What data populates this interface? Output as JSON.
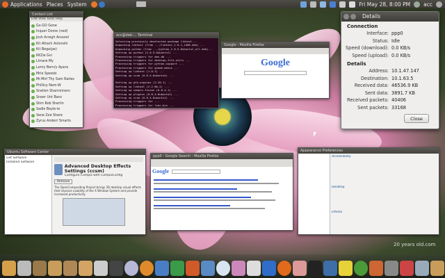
{
  "top_panel": {
    "menus": [
      "Applications",
      "Places",
      "System"
    ],
    "clock": "Fri May 28,  8:00 PM",
    "user": "acc"
  },
  "contact_list": {
    "title": "Contact List",
    "menu": [
      "Edit",
      "View",
      "Tools",
      "Help"
    ],
    "contacts": [
      "Go GO Gone",
      "Inquer Dome (ned)",
      "Josh Arregh Ansorel",
      "Kit Attach Astonshi",
      "Kit Bega(pe)",
      "KKZw Gvi",
      "Llmare My",
      "Lorny Bern/y Ayans",
      "Mrie Speeds",
      "Mr.Mnf Thy Sam Raites",
      "Phillicy Nem-W",
      "Snellen Sharrorinem",
      "Sneer Unt Banc",
      "Stim Rob Sherlin",
      "Sadie Bayle-le",
      "Vane Zoe Shere",
      "Zyrus Anderr Smarts"
    ]
  },
  "terminal": {
    "title": "acc@deb-... Terminal",
    "lines": [
      "Selecting previously deselected package libtest...",
      "Unpacking libtest (from .../libtest_1.0-1_i386.deb) ...",
      "Unpacking python (from .../python_2.6.5-0ubuntu1_all.deb)...",
      "Setting up python (2.6.5-0ubuntu1) ...",
      "Processing triggers for man-db ...",
      "Processing triggers for desktop-file-utils ...",
      "Processing triggers for python-support ...",
      "Processing triggers for gnome-menus ...",
      "Setting up libtest (1.0-1) ...",
      "Setting up ccsm (0.8.4-0ubuntu4) ...",
      "",
      "Setting up gtk-engines (2.20-1) ...",
      "Setting up libtool (2.2.6b-2) ...",
      "Setting up compiz-fusion (0.8.4-1) ...",
      "Setting up plugins (0.8.4-0ubuntu2) ...",
      "Setting up ccsm (0.8.4-0ubuntu1) ...",
      "Processing triggers for ...",
      "Processing triggers for libc-bin ...",
      "acc@deb:~$ sudo apt-get install ..."
    ]
  },
  "details": {
    "title": "Details",
    "connection_heading": "Connection",
    "connection": [
      {
        "key": "Interface:",
        "value": "ppp0"
      },
      {
        "key": "Status:",
        "value": "Idle"
      },
      {
        "key": "Speed (download):",
        "value": "0.0 KB/s"
      },
      {
        "key": "Speed (upload):",
        "value": "0.0 KB/s"
      }
    ],
    "details_heading": "Details",
    "details": [
      {
        "key": "Address:",
        "value": "10.1.47.147"
      },
      {
        "key": "Destination:",
        "value": "10.1.63.5"
      },
      {
        "key": "Received data:",
        "value": "46536.9 KB"
      },
      {
        "key": "Sent data:",
        "value": "3891.7 KB"
      },
      {
        "key": "Received packets:",
        "value": "40406"
      },
      {
        "key": "Sent packets:",
        "value": "33168"
      }
    ],
    "close_label": "Close"
  },
  "software_center": {
    "title": "Ubuntu Software Center",
    "heading": "Advanced Desktop Effects Settings (ccsm)",
    "sub": "Configure Compiz with CompizConfig",
    "text": "The OpenCompositing Project brings 3D desktop visual effects that improve usability of the X Window System and provide increased productivity.",
    "button": "Remove",
    "sidebar": [
      "Get Software",
      "Installed Software"
    ]
  },
  "browser_small": {
    "title": "Google - Mozilla Firefox",
    "logo": "Google"
  },
  "browser_big": {
    "title": "ppp0 - Google Search - Mozilla Firefox",
    "logo": "Google"
  },
  "appearance": {
    "title": "Appearance Preferences",
    "sections": [
      "Accessibility",
      "Desktop",
      "Effects"
    ]
  },
  "watermark": "20 years old.com",
  "colors": {
    "terminal_bg": "#2c0a1f",
    "panel": "#3c3b37",
    "accent_orange": "#e76b25"
  }
}
